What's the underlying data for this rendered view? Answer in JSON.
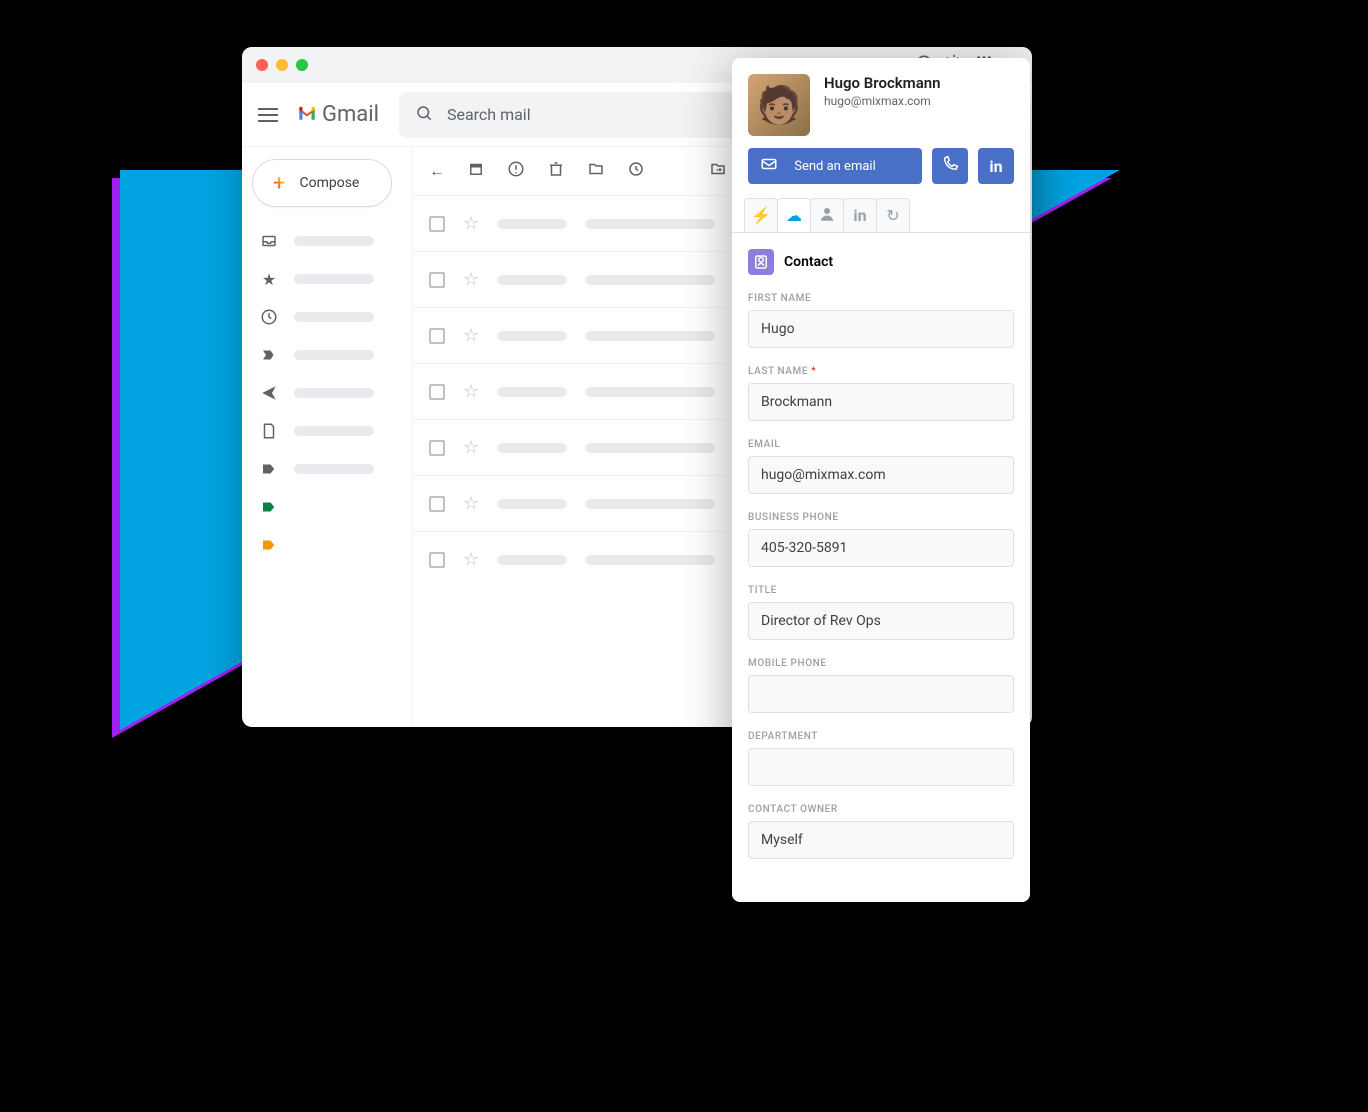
{
  "gmail": {
    "brand": "Gmail",
    "search_placeholder": "Search mail",
    "compose": "Compose"
  },
  "contact": {
    "name": "Hugo Brockmann",
    "email": "hugo@mixmax.com",
    "actions": {
      "send_email": "Send an email"
    },
    "section_title": "Contact",
    "fields": {
      "first_name": {
        "label": "FIRST NAME",
        "value": "Hugo"
      },
      "last_name": {
        "label": "LAST NAME",
        "value": "Brockmann",
        "required": true
      },
      "email": {
        "label": "EMAIL",
        "value": "hugo@mixmax.com"
      },
      "business_phone": {
        "label": "BUSINESS PHONE",
        "value": "405-320-5891"
      },
      "title": {
        "label": "TITLE",
        "value": "Director of Rev Ops"
      },
      "mobile_phone": {
        "label": "MOBILE PHONE",
        "value": ""
      },
      "department": {
        "label": "DEPARTMENT",
        "value": ""
      },
      "contact_owner": {
        "label": "CONTACT OWNER",
        "value": "Myself"
      }
    }
  }
}
